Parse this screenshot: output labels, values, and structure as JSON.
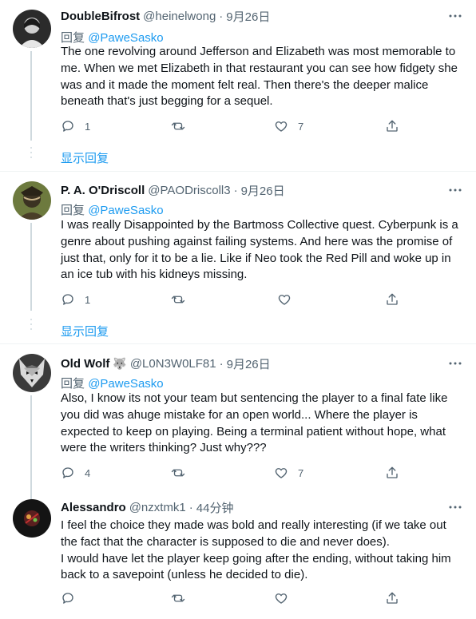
{
  "colors": {
    "accent": "#1d9bf0",
    "text": "#0f1419",
    "muted": "#536471",
    "border": "#eff3f4",
    "thread": "#cfd9de"
  },
  "replies": [
    {
      "name": "DoubleBifrost",
      "handle": "@heinelwong",
      "separator": "·",
      "time": "9月26日",
      "replying_label": "回复",
      "replying_to": "@PaweSasko",
      "text": "The one revolving around Jefferson and Elizabeth was most memorable to me. When we met Elizabeth in that restaurant you can see how fidgety she was and it made the moment felt real. Then there's the deeper malice beneath that's just begging for a sequel.",
      "reply_count": "1",
      "retweet_count": "",
      "like_count": "7",
      "show_replies": "显示回复",
      "avatar_icon": "portrait-avatar-icon"
    },
    {
      "name": "P. A. O'Driscoll",
      "handle": "@PAODriscoll3",
      "separator": "·",
      "time": "9月26日",
      "replying_label": "回复",
      "replying_to": "@PaweSasko",
      "text": "I was really Disappointed by the Bartmoss Collective quest. Cyberpunk is a genre about pushing against failing systems. And here was the promise of just that, only for it to be a lie. Like if Neo took the Red Pill and woke up in an ice tub with his kidneys missing.",
      "reply_count": "1",
      "retweet_count": "",
      "like_count": "",
      "show_replies": "显示回复",
      "avatar_icon": "warrior-avatar-icon"
    },
    {
      "name": "Old Wolf",
      "badge": "🐺",
      "handle": "@L0N3W0LF81",
      "separator": "·",
      "time": "9月26日",
      "replying_label": "回复",
      "replying_to": "@PaweSasko",
      "text": "Also, I know its not your team but sentencing the player to a final fate like you did was ahuge mistake for an open world... Where the player is expected to keep on playing. Being a terminal patient without hope, what were the writers thinking? Just why???",
      "reply_count": "4",
      "retweet_count": "",
      "like_count": "7",
      "avatar_icon": "wolf-avatar-icon"
    },
    {
      "name": "Alessandro",
      "handle": "@nzxtmk1",
      "separator": "·",
      "time": "44分钟",
      "text_lines": [
        "I feel the choice they made was bold and really interesting (if we take out the fact that the character is supposed to die and never does).",
        "I would have let the player keep going after the ending, without taking him back to a savepoint (unless he decided to die)."
      ],
      "reply_count": "",
      "retweet_count": "",
      "like_count": "",
      "avatar_icon": "dark-art-avatar-icon"
    }
  ]
}
